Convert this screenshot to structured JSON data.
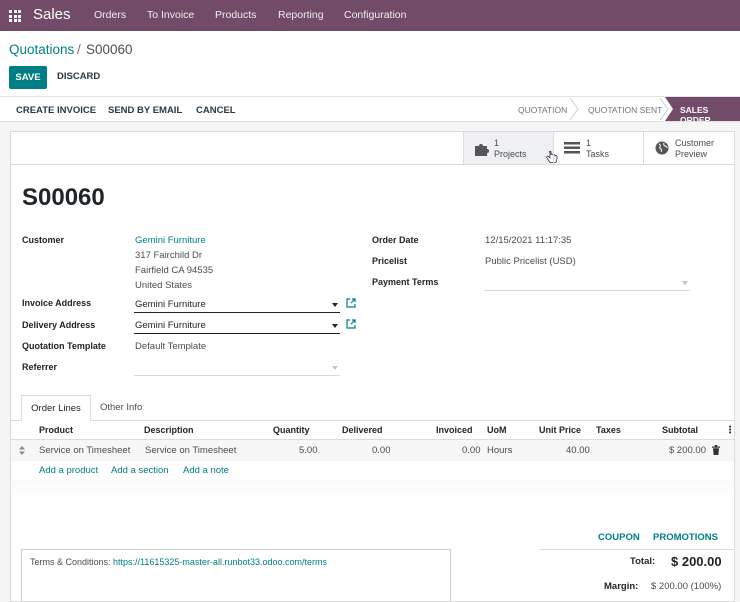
{
  "navbar": {
    "app_name": "Sales",
    "menu": [
      "Orders",
      "To Invoice",
      "Products",
      "Reporting",
      "Configuration"
    ]
  },
  "breadcrumb": {
    "parent": "Quotations",
    "separator": "/",
    "current": "S00060"
  },
  "actions": {
    "save": "SAVE",
    "discard": "DISCARD"
  },
  "statusbar": {
    "buttons": [
      "CREATE INVOICE",
      "SEND BY EMAIL",
      "CANCEL"
    ],
    "stages": [
      "QUOTATION",
      "QUOTATION SENT",
      "SALES ORDER"
    ],
    "active_stage": "SALES ORDER"
  },
  "smart_buttons": {
    "projects": {
      "count": "1",
      "label": "Projects"
    },
    "tasks": {
      "count": "1",
      "label": "Tasks"
    },
    "preview": {
      "line1": "Customer",
      "line2": "Preview"
    }
  },
  "record": {
    "name": "S00060",
    "labels": {
      "customer": "Customer",
      "invoice_address": "Invoice Address",
      "delivery_address": "Delivery Address",
      "quotation_template": "Quotation Template",
      "referrer": "Referrer",
      "order_date": "Order Date",
      "pricelist": "Pricelist",
      "payment_terms": "Payment Terms"
    },
    "customer": "Gemini Furniture",
    "address": [
      "317 Fairchild Dr",
      "Fairfield CA 94535",
      "United States"
    ],
    "invoice_address": "Gemini Furniture",
    "delivery_address": "Gemini Furniture",
    "quotation_template": "Default Template",
    "referrer": "",
    "order_date": "12/15/2021 11:17:35",
    "pricelist": "Public Pricelist (USD)",
    "payment_terms": ""
  },
  "tabs": [
    "Order Lines",
    "Other Info"
  ],
  "order_lines": {
    "columns": [
      "Product",
      "Description",
      "Quantity",
      "Delivered",
      "Invoiced",
      "UoM",
      "Unit Price",
      "Taxes",
      "Subtotal"
    ],
    "rows": [
      {
        "product": "Service on Timesheet",
        "description": "Service on Timesheet",
        "quantity": "5.00",
        "delivered": "0.00",
        "invoiced": "0.00",
        "uom": "Hours",
        "unit_price": "40.00",
        "taxes": "",
        "subtotal": "$ 200.00"
      }
    ],
    "add_links": [
      "Add a product",
      "Add a section",
      "Add a note"
    ]
  },
  "totals": {
    "coupon": "COUPON",
    "promotions": "PROMOTIONS",
    "total_label": "Total:",
    "total": "$ 200.00",
    "margin_label": "Margin:",
    "margin": "$ 200.00 (100%)"
  },
  "terms": {
    "label": "Terms & Conditions:",
    "url": "https://11615325-master-all.runbot33.odoo.com/terms"
  },
  "colors": {
    "brand": "#714b67",
    "accent": "#017e84"
  }
}
